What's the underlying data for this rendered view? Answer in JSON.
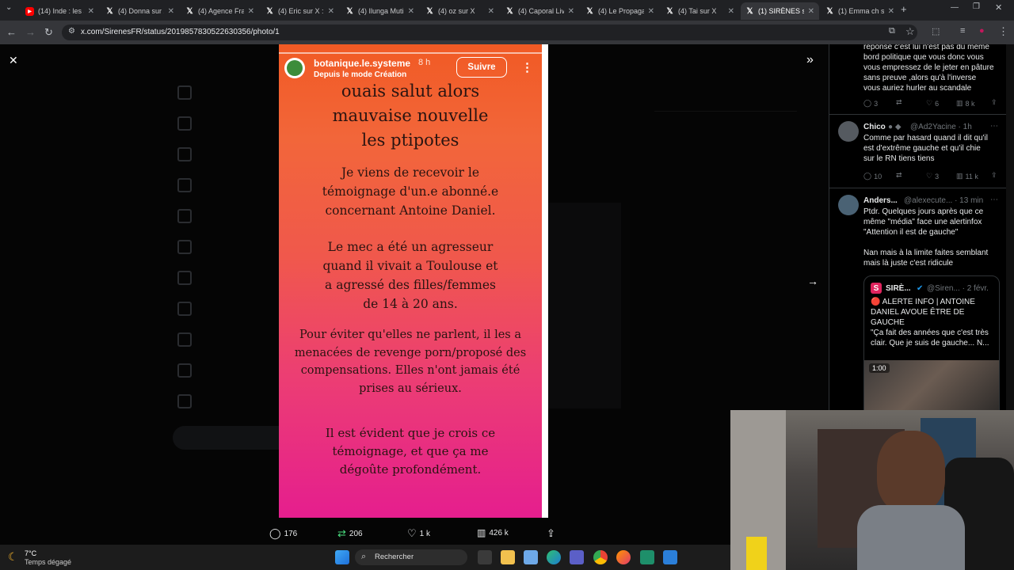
{
  "browser": {
    "tabs": [
      {
        "label": "(14) Inde : les a",
        "favicon": "youtube-icon"
      },
      {
        "label": "(4) Donna sur X",
        "favicon": "x-icon"
      },
      {
        "label": "(4) Agence Fra",
        "favicon": "x-icon"
      },
      {
        "label": "(4) Eric sur X :",
        "favicon": "x-icon"
      },
      {
        "label": "(4) Ilunga Muti",
        "favicon": "x-icon"
      },
      {
        "label": "(4) oz sur X",
        "favicon": "x-icon"
      },
      {
        "label": "(4) Caporal Liv",
        "favicon": "x-icon"
      },
      {
        "label": "(4) Le Propaga",
        "favicon": "x-icon"
      },
      {
        "label": "(4) Tai sur X",
        "favicon": "x-icon"
      },
      {
        "label": "(1) SIRÈNES su",
        "favicon": "x-icon",
        "active": true
      },
      {
        "label": "(1) Emma ch su",
        "favicon": "x-icon"
      }
    ],
    "url": "x.com/SirenesFR/status/2019857830522630356/photo/1"
  },
  "story": {
    "username": "botanique.le.systeme",
    "time": "8 h",
    "subtitle": "Depuis le mode Création",
    "follow": "Suivre",
    "paragraphs": [
      [
        "ouais salut alors",
        "mauvaise nouvelle",
        "les ptipotes"
      ],
      [
        "Je viens de recevoir le",
        "témoignage d'un.e abonné.e",
        "concernant Antoine Daniel."
      ],
      [
        "Le mec a été un agresseur",
        "quand il vivait a Toulouse et",
        "a agressé des filles/femmes",
        "de 14 à 20 ans."
      ],
      [
        "Pour éviter qu'elles ne parlent, il les a",
        "menacées de revenge porn/proposé des",
        "compensations. Elles n'ont jamais été",
        "prises au sérieux."
      ],
      [
        "Il est évident que je crois ce",
        "témoignage, et que ça me",
        "dégoûte profondément."
      ]
    ]
  },
  "actions": {
    "replies": "176",
    "reposts": "206",
    "likes": "1 k",
    "views": "426 k"
  },
  "replies": {
    "reply0": {
      "lines": [
        "réponse c'est lui n'est pas du même",
        "bord politique que vous donc vous",
        "vous empressez de le jeter en pâture",
        "sans preuve ,alors qu'à l'inverse",
        "vous auriez hurler au scandale"
      ],
      "stats": {
        "replies": "3",
        "likes": "6",
        "views": "8 k"
      }
    },
    "reply1": {
      "name": "Chico",
      "handle": "@Ad2Yacine · 1h",
      "lines": [
        "Comme par hasard quand il dit qu'il",
        "est d'extrême gauche et qu'il chie",
        "sur le RN tiens tiens"
      ],
      "stats": {
        "replies": "10",
        "reposts": "3",
        "views": "11 k"
      }
    },
    "reply2": {
      "name": "Anders...",
      "handle": "@alexecute... · 13 min",
      "lines": [
        "Ptdr. Quelques jours après que ce",
        "même \"média\" face une alertinfox",
        "\"Attention il est de gauche\"",
        "",
        "Nan mais à la limite faites semblant",
        "mais là juste c'est ridicule"
      ]
    },
    "quote": {
      "name": "SIRÈ...",
      "handle": "@Siren... · 2 févr.",
      "lines": [
        "🔴 ALERTE INFO | ANTOINE",
        "DANIEL AVOUE ÊTRE DE",
        "GAUCHE",
        "\"Ça fait des années que c'est très",
        "clair. Que je suis de gauche... N..."
      ],
      "video_time": "1:00"
    }
  },
  "taskbar": {
    "weather_temp": "7°C",
    "weather_desc": "Temps dégagé",
    "search": "Rechercher"
  }
}
